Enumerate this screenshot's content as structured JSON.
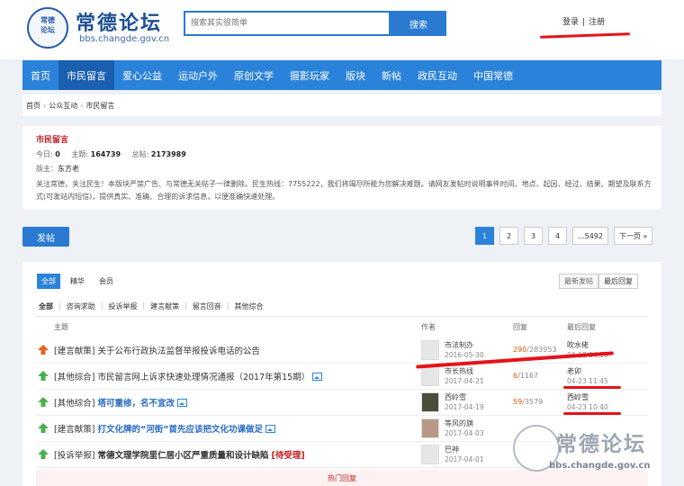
{
  "header": {
    "logo_title": "常德论坛",
    "logo_url": "bbs.changde.gov.cn",
    "seal_text": "常德论坛",
    "search_placeholder": "搜索其实很简单",
    "search_button": "搜索",
    "login": "登录",
    "auth_sep": "|",
    "register": "注册"
  },
  "nav": {
    "items": [
      "首页",
      "市民留言",
      "爱心公益",
      "运动户外",
      "原创文学",
      "摄影玩家",
      "版块",
      "新帖",
      "政民互动",
      "中国常德"
    ],
    "active_index": 1
  },
  "breadcrumb": [
    "首页",
    "公众互动",
    "市民留言"
  ],
  "board": {
    "name": "市民留言",
    "today_label": "今日:",
    "today_value": "0",
    "topics_label": "主题:",
    "topics_value": "164739",
    "posts_label": "总帖:",
    "posts_value": "2173989",
    "mods_label": "版主：",
    "mods_value": "东方老",
    "description": "关注常德，关注民生！本版块严禁广告、与常德无关帖子一律删除。民生热线：7755222，我们将竭尽所能为您解决难题。请网友发帖时说明事件时间、地点、起因、经过、结果、期望及联系方式(可发站内短信)，提供真实、准确、合理的诉求信息，以便准确快速处理。"
  },
  "actions": {
    "post_button": "发帖"
  },
  "pager": [
    "1",
    "2",
    "3",
    "4",
    "...5492",
    "下一页 »"
  ],
  "list": {
    "filters": [
      "全部",
      "精华",
      "会员"
    ],
    "sorts": [
      "最新发帖",
      "最后回复"
    ],
    "categories": [
      "全部",
      "咨询求助",
      "投诉举报",
      "建言献策",
      "留言回音",
      "其他综合"
    ],
    "headers": {
      "topic": "主题",
      "author": "作者",
      "replies": "回复",
      "last": "最后回复"
    },
    "rows": [
      {
        "category": "[建言献策]",
        "title": "关于公布行政执法监督举报投诉电话的公告",
        "author": "市法制办",
        "author_date": "2016-05-30",
        "reply": "290",
        "views": "/283953",
        "last_user": "吹水佬",
        "last_date": "04-18 14:10"
      },
      {
        "category": "[其他综合]",
        "title": "市民留言网上诉求快速处理情况通报（2017年第15期）",
        "author": "市长热线",
        "author_date": "2017-04-21",
        "reply": "6",
        "views": "/1167",
        "last_user": "老卯",
        "last_date": "04-23 11:45"
      },
      {
        "category": "[其他综合]",
        "title": "塔可重修，名不宜改",
        "author": "西岭雪",
        "author_date": "2017-04-19",
        "reply": "59",
        "views": "/3579",
        "last_user": "西岭雪",
        "last_date": "04-23 10:40"
      },
      {
        "category": "[建言献策]",
        "title": "打文化牌的“河街”首先应该把文化功课做足",
        "author": "等风的旗",
        "author_date": "2017-04-03",
        "reply": "",
        "views": "",
        "last_user": "",
        "last_date": ""
      },
      {
        "category": "[投诉举报]",
        "title": "常德文理学院里仁居小区严重质量和设计缺陷",
        "status": "[待受理]",
        "author": "巴神",
        "author_date": "2017-04-01",
        "reply": "",
        "views": "",
        "last_user": "",
        "last_date": ""
      }
    ],
    "hot_label": "热门回复"
  },
  "watermark": {
    "title": "常德论坛",
    "url": "bbs.changde.gov.cn"
  },
  "colors": {
    "nav_blue": "#2a82da",
    "brand_red": "#c21f20",
    "annotation_red": "#e4131a"
  }
}
